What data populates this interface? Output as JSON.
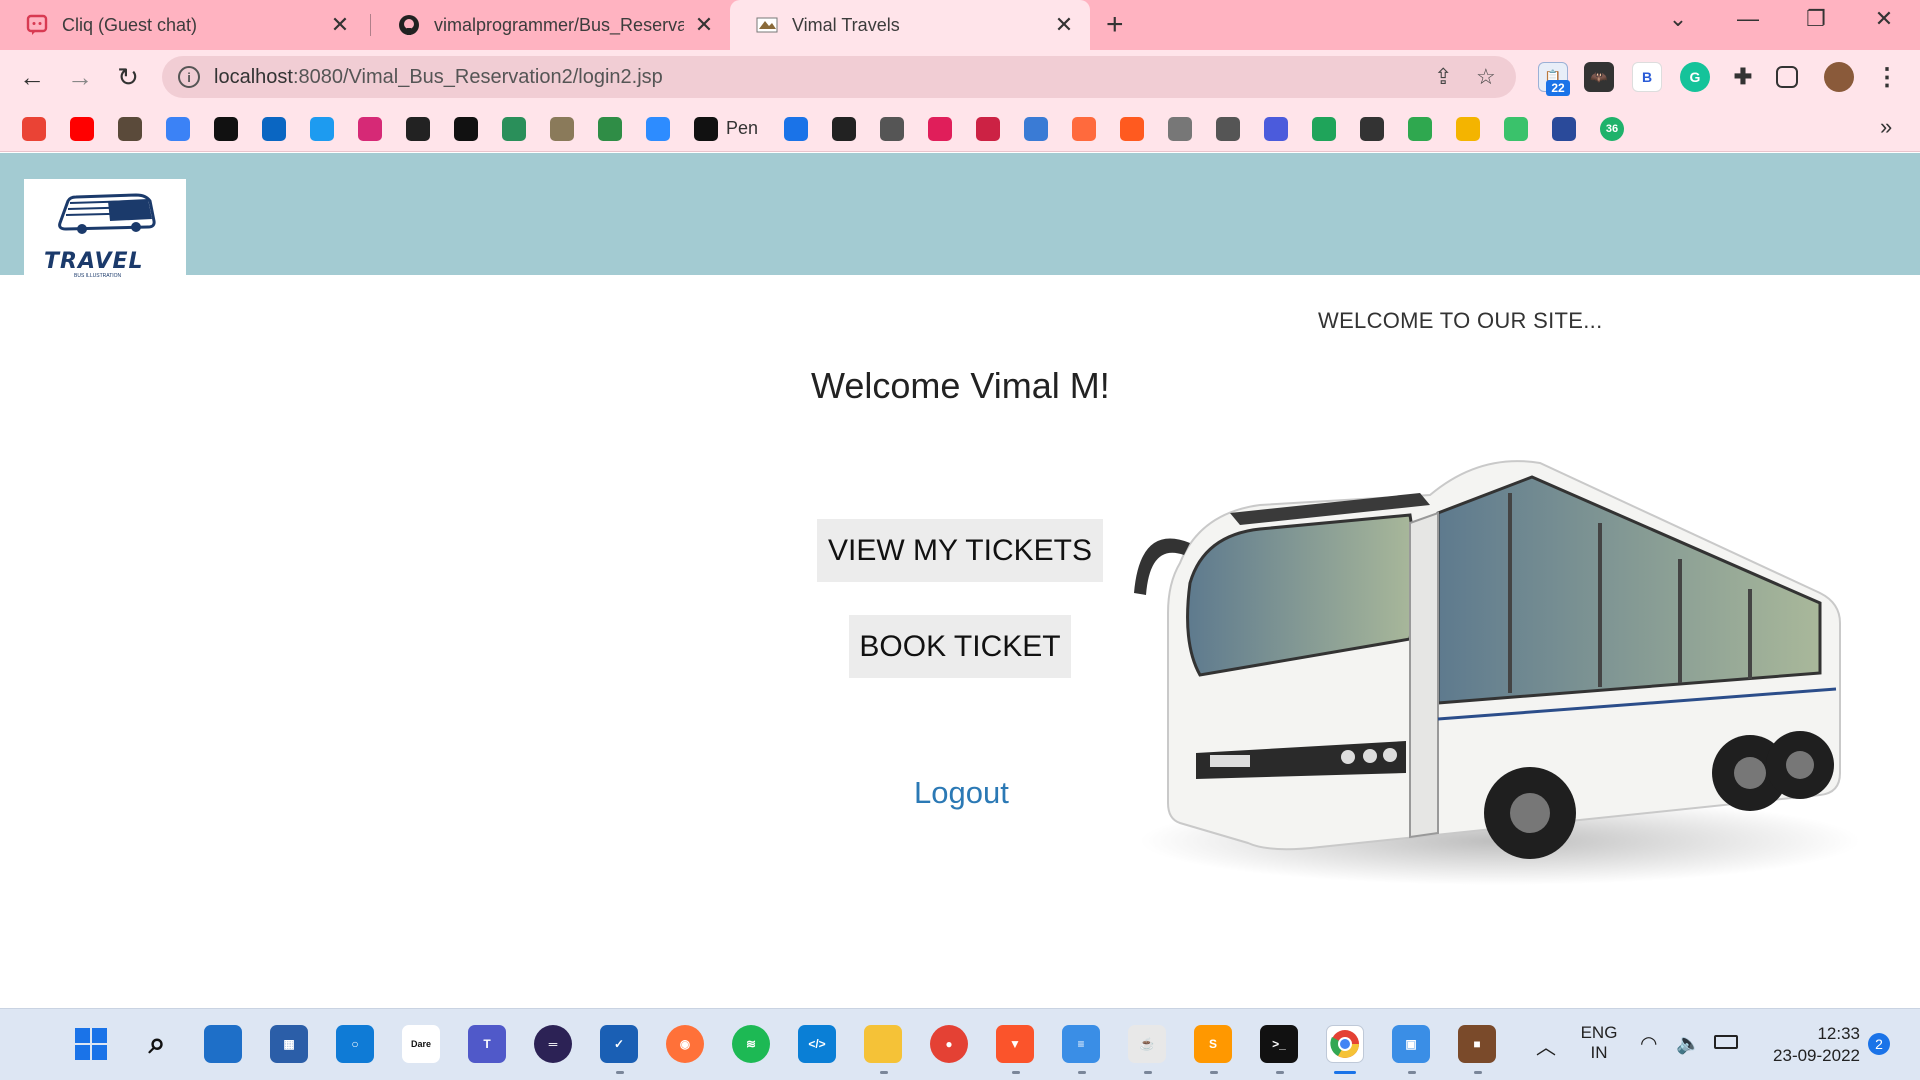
{
  "browser": {
    "tabs": [
      {
        "title": "Cliq (Guest chat)",
        "icon": "chat-icon",
        "active": false
      },
      {
        "title": "vimalprogrammer/Bus_Reservatio",
        "icon": "github-icon",
        "active": false
      },
      {
        "title": "Vimal Travels",
        "icon": "bus-favicon",
        "active": true
      }
    ],
    "address": {
      "host": "localhost",
      "path": ":8080/Vimal_Bus_Reservation2/login2.jsp"
    },
    "extension_badge": "22",
    "bookmarks": [
      {
        "icon": "gmail-icon",
        "color": "#ea4335"
      },
      {
        "icon": "youtube-icon",
        "color": "#ff0000"
      },
      {
        "icon": "cc-icon",
        "color": "#5a4a3a"
      },
      {
        "icon": "chart-icon",
        "color": "#3b82f6"
      },
      {
        "icon": "hackerrank-icon",
        "color": "#111111"
      },
      {
        "icon": "linkedin-icon",
        "color": "#0a66c2"
      },
      {
        "icon": "twitter-icon",
        "color": "#1d9bf0"
      },
      {
        "icon": "instagram-icon",
        "color": "#d62976"
      },
      {
        "icon": "github-icon",
        "color": "#222222"
      },
      {
        "icon": "codechef-icon",
        "color": "#111111"
      },
      {
        "icon": "map-icon",
        "color": "#2a8f5a"
      },
      {
        "icon": "gov-emblem-icon",
        "color": "#8a7a5a"
      },
      {
        "icon": "geeksforgeeks-icon",
        "color": "#2f8d46"
      },
      {
        "icon": "zoom-icon",
        "color": "#2d8cff"
      },
      {
        "icon": "codepen-icon",
        "color": "#111111"
      },
      {
        "icon": "webflow-icon",
        "color": "#1a73e8"
      },
      {
        "icon": "globe-icon",
        "color": "#222222"
      },
      {
        "icon": "telegram-icon",
        "color": "#555555"
      },
      {
        "icon": "slack-icon",
        "color": "#e01e5a"
      },
      {
        "icon": "notification-icon",
        "color": "#cc2244"
      },
      {
        "icon": "puzzle-icon",
        "color": "#3a7bd5"
      },
      {
        "icon": "b-icon",
        "color": "#ff6a3d"
      },
      {
        "icon": "orange-icon",
        "color": "#ff5a1f"
      },
      {
        "icon": "building-icon",
        "color": "#777777"
      },
      {
        "icon": "trend-icon",
        "color": "#555555"
      },
      {
        "icon": "circle-icon",
        "color": "#4b5bdc"
      },
      {
        "icon": "tree-icon",
        "color": "#1fa45a"
      },
      {
        "icon": "news-icon",
        "color": "#333333"
      },
      {
        "icon": "leaf-icon",
        "color": "#2fa84f"
      },
      {
        "icon": "kite-icon",
        "color": "#f4b400"
      },
      {
        "icon": "asterisk-icon",
        "color": "#3ac26b"
      },
      {
        "icon": "unacademy-icon",
        "color": "#2a4a9a"
      },
      {
        "icon": "count-icon",
        "color": "#1fb26b"
      }
    ],
    "bookmark_pen_label": "Pen",
    "bookmark_36_label": "36",
    "bookmark_overflow": "»"
  },
  "site": {
    "logo_text": "TRAVEL",
    "logo_sub": "BUS ILLUSTRATION",
    "marquee": "WELCOME TO OUR SITE...",
    "welcome": "Welcome Vimal M!",
    "view_tickets": "VIEW MY TICKETS",
    "book_ticket": "BOOK TICKET",
    "logout": "Logout"
  },
  "taskbar": {
    "lang_line1": "ENG",
    "lang_line2": "IN",
    "time": "12:33",
    "date": "23-09-2022",
    "notification_count": "2"
  }
}
